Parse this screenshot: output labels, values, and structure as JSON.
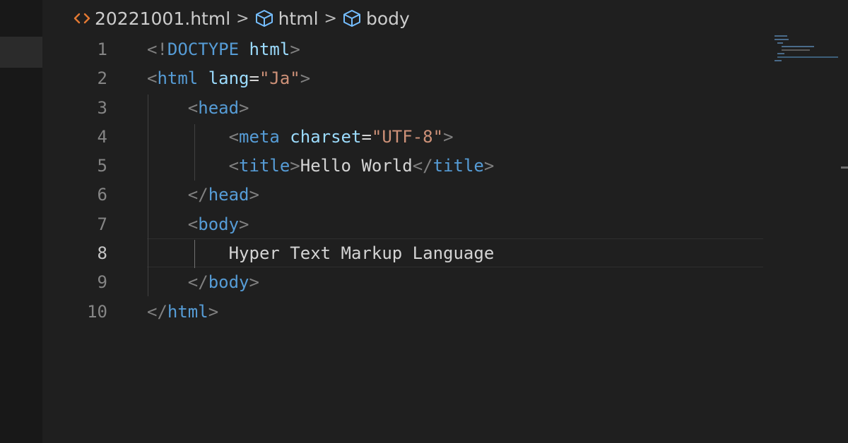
{
  "breadcrumb": {
    "file": "20221001.html",
    "path1": "html",
    "path2": "body",
    "separator": ">"
  },
  "editor": {
    "active_line": 8,
    "line_numbers": [
      "1",
      "2",
      "3",
      "4",
      "5",
      "6",
      "7",
      "8",
      "9",
      "10"
    ],
    "lines": [
      [
        {
          "t": "<!",
          "c": "pun"
        },
        {
          "t": "DOCTYPE",
          "c": "tag"
        },
        {
          "t": " ",
          "c": "txt"
        },
        {
          "t": "html",
          "c": "attr"
        },
        {
          "t": ">",
          "c": "pun"
        }
      ],
      [
        {
          "t": "<",
          "c": "pun"
        },
        {
          "t": "html",
          "c": "tag"
        },
        {
          "t": " ",
          "c": "txt"
        },
        {
          "t": "lang",
          "c": "attr"
        },
        {
          "t": "=",
          "c": "txt"
        },
        {
          "t": "\"Ja\"",
          "c": "str"
        },
        {
          "t": ">",
          "c": "pun"
        }
      ],
      [
        {
          "t": "    ",
          "c": "txt"
        },
        {
          "t": "<",
          "c": "pun"
        },
        {
          "t": "head",
          "c": "tag"
        },
        {
          "t": ">",
          "c": "pun"
        }
      ],
      [
        {
          "t": "        ",
          "c": "txt"
        },
        {
          "t": "<",
          "c": "pun"
        },
        {
          "t": "meta",
          "c": "tag"
        },
        {
          "t": " ",
          "c": "txt"
        },
        {
          "t": "charset",
          "c": "attr"
        },
        {
          "t": "=",
          "c": "txt"
        },
        {
          "t": "\"UTF-8\"",
          "c": "str"
        },
        {
          "t": ">",
          "c": "pun"
        }
      ],
      [
        {
          "t": "        ",
          "c": "txt"
        },
        {
          "t": "<",
          "c": "pun"
        },
        {
          "t": "title",
          "c": "tag"
        },
        {
          "t": ">",
          "c": "pun"
        },
        {
          "t": "Hello World",
          "c": "txt"
        },
        {
          "t": "</",
          "c": "pun"
        },
        {
          "t": "title",
          "c": "tag"
        },
        {
          "t": ">",
          "c": "pun"
        }
      ],
      [
        {
          "t": "    ",
          "c": "txt"
        },
        {
          "t": "</",
          "c": "pun"
        },
        {
          "t": "head",
          "c": "tag"
        },
        {
          "t": ">",
          "c": "pun"
        }
      ],
      [
        {
          "t": "    ",
          "c": "txt"
        },
        {
          "t": "<",
          "c": "pun"
        },
        {
          "t": "body",
          "c": "tag"
        },
        {
          "t": ">",
          "c": "pun"
        }
      ],
      [
        {
          "t": "        ",
          "c": "txt"
        },
        {
          "t": "Hyper Text Markup Language",
          "c": "txt"
        }
      ],
      [
        {
          "t": "    ",
          "c": "txt"
        },
        {
          "t": "</",
          "c": "pun"
        },
        {
          "t": "body",
          "c": "tag"
        },
        {
          "t": ">",
          "c": "pun"
        }
      ],
      [
        {
          "t": "</",
          "c": "pun"
        },
        {
          "t": "html",
          "c": "tag"
        },
        {
          "t": ">",
          "c": "pun"
        }
      ]
    ]
  },
  "colors": {
    "background": "#1f1f1f",
    "tag": "#569cd6",
    "attribute": "#9cdcfe",
    "string": "#ce9178",
    "punctuation": "#808080",
    "text": "#d4d4d4",
    "line_number": "#858585",
    "file_icon": "#e37933"
  },
  "icons": {
    "file": "html-file-icon",
    "element": "cube-icon",
    "separator": "chevron-right-icon"
  }
}
